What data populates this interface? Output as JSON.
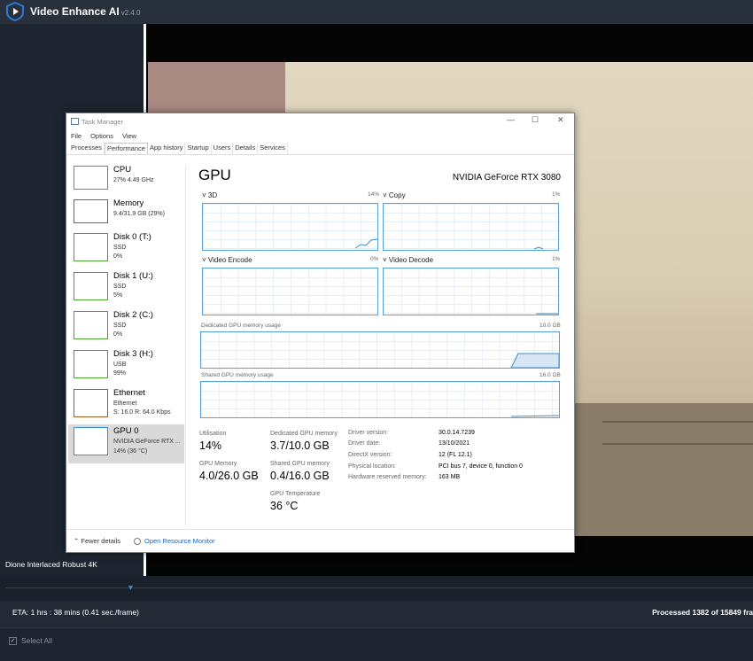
{
  "app": {
    "title": "Video Enhance AI",
    "version": "v2.4.0",
    "model": "Dione Interlaced Robust 4K"
  },
  "status": {
    "eta": "ETA:  1 hrs : 38 mins  (0.41 sec./frame)",
    "processed": "Processed 1382 of 15849 fra",
    "select_all": "Select All"
  },
  "taskmanager": {
    "title": "Task Manager",
    "menu": [
      "File",
      "Options",
      "View"
    ],
    "tabs": [
      "Processes",
      "Performance",
      "App history",
      "Startup",
      "Users",
      "Details",
      "Services"
    ],
    "active_tab": "Performance",
    "sidebar": [
      {
        "name": "CPU",
        "line1": "27%  4.49 GHz",
        "line2": "",
        "line3": "",
        "color": "#3a8fd1"
      },
      {
        "name": "Memory",
        "line1": "9.4/31.9 GB (29%)",
        "line2": "",
        "line3": "",
        "color": "#9a3fb0"
      },
      {
        "name": "Disk 0 (T:)",
        "line1": "SSD",
        "line2": "0%",
        "line3": "",
        "color": "#4aa12e"
      },
      {
        "name": "Disk 1 (U:)",
        "line1": "SSD",
        "line2": "5%",
        "line3": "",
        "color": "#4aa12e"
      },
      {
        "name": "Disk 2 (C:)",
        "line1": "SSD",
        "line2": "0%",
        "line3": "",
        "color": "#4aa12e"
      },
      {
        "name": "Disk 3 (H:)",
        "line1": "USB",
        "line2": "99%",
        "line3": "",
        "color": "#4aa12e"
      },
      {
        "name": "Ethernet",
        "line1": "Ethernet",
        "line2": "S: 16.0  R: 64.0 Kbps",
        "line3": "",
        "color": "#a65a1e"
      },
      {
        "name": "GPU 0",
        "line1": "NVIDIA GeForce RTX ...",
        "line2": "14% (36 °C)",
        "line3": "",
        "color": "#3a8fd1"
      }
    ],
    "gpu": {
      "heading": "GPU",
      "model": "NVIDIA GeForce RTX 3080",
      "engines": [
        {
          "label": "3D",
          "pct": "14%"
        },
        {
          "label": "Copy",
          "pct": "1%"
        },
        {
          "label": "Video Encode",
          "pct": "0%"
        },
        {
          "label": "Video Decode",
          "pct": "1%"
        }
      ],
      "dedicated_label": "Dedicated GPU memory usage",
      "dedicated_max": "10.0 GB",
      "shared_label": "Shared GPU memory usage",
      "shared_max": "16.0 GB",
      "stats": [
        {
          "label": "Utilisation",
          "value": "14%"
        },
        {
          "label": "Dedicated GPU memory",
          "value": "3.7/10.0 GB"
        },
        {
          "label": "GPU Memory",
          "value": "4.0/26.0 GB"
        },
        {
          "label": "Shared GPU memory",
          "value": "0.4/16.0 GB"
        },
        {
          "label": "GPU Temperature",
          "value": "36 °C"
        }
      ],
      "info": [
        {
          "label": "Driver version:",
          "value": "30.0.14.7239"
        },
        {
          "label": "Driver date:",
          "value": "13/10/2021"
        },
        {
          "label": "DirectX version:",
          "value": "12 (FL 12.1)"
        },
        {
          "label": "Physical location:",
          "value": "PCI bus 7, device 0, function 0"
        },
        {
          "label": "Hardware reserved memory:",
          "value": "163 MB"
        }
      ]
    },
    "footer": {
      "fewer": "Fewer details",
      "orm": "Open Resource Monitor"
    }
  }
}
